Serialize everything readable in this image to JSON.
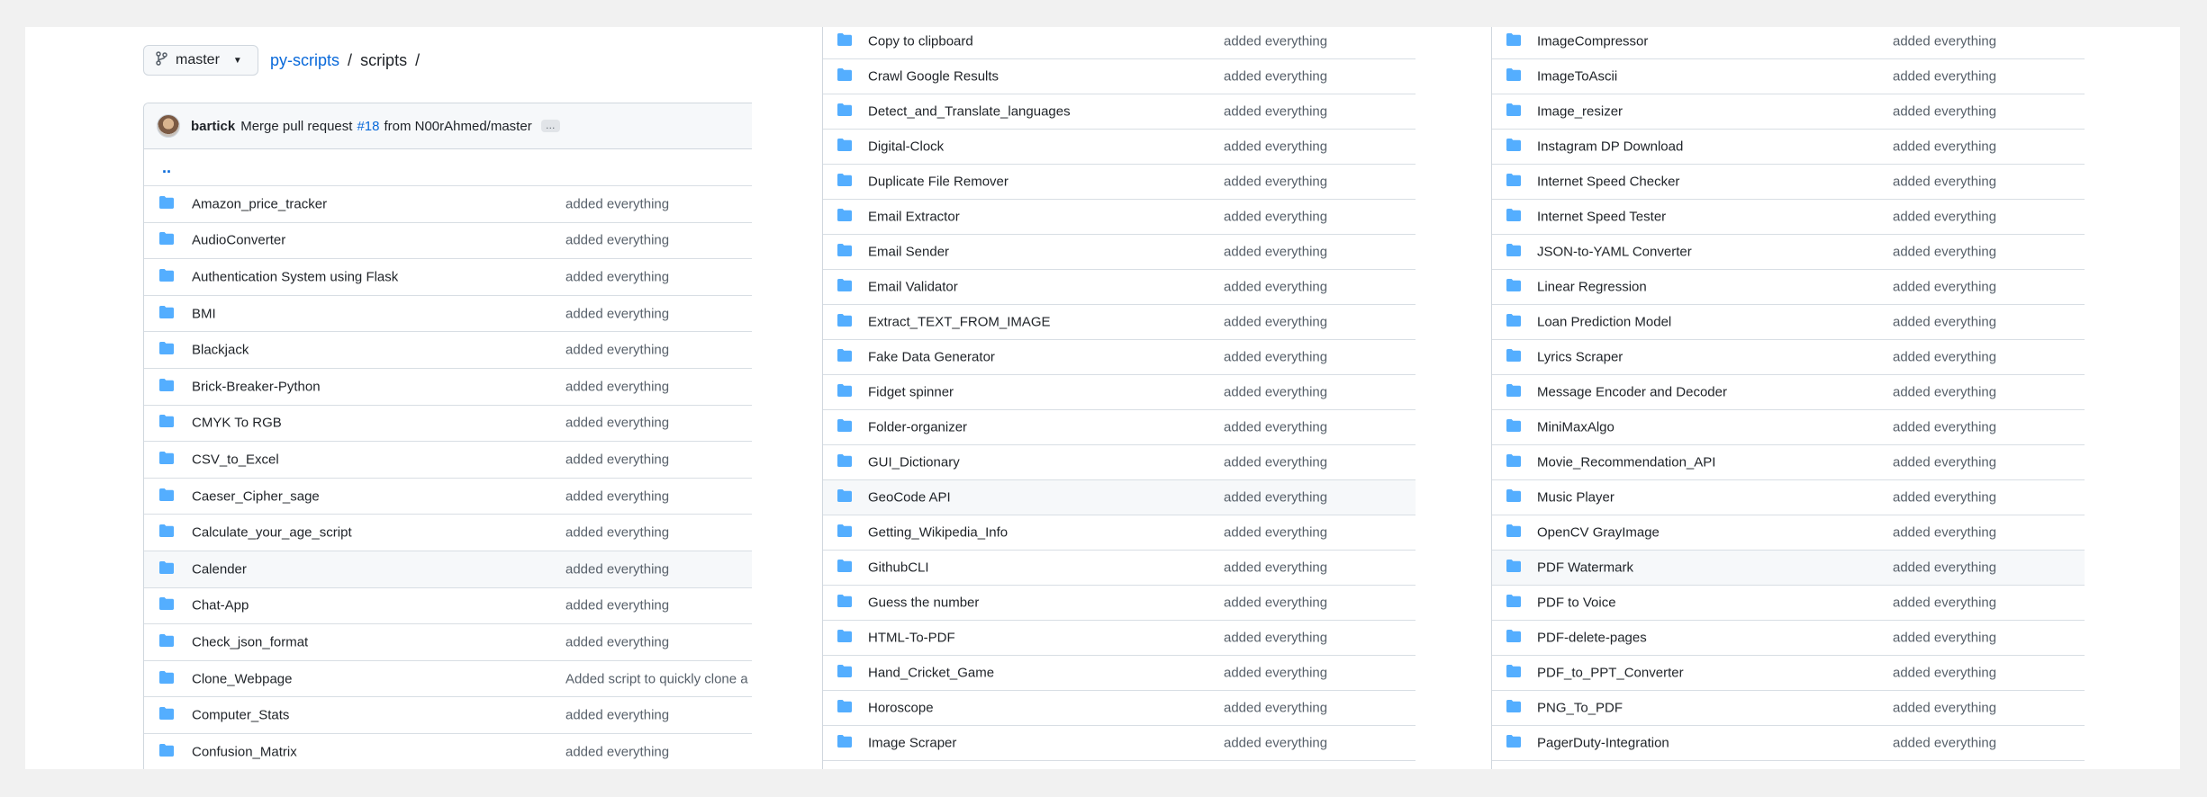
{
  "header": {
    "branch": "master",
    "repo_link": "py-scripts",
    "separator": "/",
    "folder": "scripts",
    "trailing_sep": "/"
  },
  "commit": {
    "author": "bartick",
    "message_prefix": "Merge pull request",
    "pr_number": "#18",
    "message_suffix": "from N00rAhmed/master",
    "ellipsis": "…"
  },
  "parent_dir": "..",
  "colors": {
    "folder": "#54aeff",
    "link": "#0969da"
  },
  "panel1": [
    {
      "name": "Amazon_price_tracker",
      "msg": "added everything"
    },
    {
      "name": "AudioConverter",
      "msg": "added everything"
    },
    {
      "name": "Authentication System using Flask",
      "msg": "added everything"
    },
    {
      "name": "BMI",
      "msg": "added everything"
    },
    {
      "name": "Blackjack",
      "msg": "added everything"
    },
    {
      "name": "Brick-Breaker-Python",
      "msg": "added everything"
    },
    {
      "name": "CMYK To RGB",
      "msg": "added everything"
    },
    {
      "name": "CSV_to_Excel",
      "msg": "added everything"
    },
    {
      "name": "Caeser_Cipher_sage",
      "msg": "added everything"
    },
    {
      "name": "Calculate_your_age_script",
      "msg": "added everything"
    },
    {
      "name": "Calender",
      "msg": "added everything"
    },
    {
      "name": "Chat-App",
      "msg": "added everything"
    },
    {
      "name": "Check_json_format",
      "msg": "added everything"
    },
    {
      "name": "Clone_Webpage",
      "msg": "Added script to quickly clone a"
    },
    {
      "name": "Computer_Stats",
      "msg": "added everything"
    },
    {
      "name": "Confusion_Matrix",
      "msg": "added everything"
    }
  ],
  "panel2": [
    {
      "name": "Copy to clipboard",
      "msg": "added everything"
    },
    {
      "name": "Crawl Google Results",
      "msg": "added everything"
    },
    {
      "name": "Detect_and_Translate_languages",
      "msg": "added everything"
    },
    {
      "name": "Digital-Clock",
      "msg": "added everything"
    },
    {
      "name": "Duplicate File Remover",
      "msg": "added everything"
    },
    {
      "name": "Email Extractor",
      "msg": "added everything"
    },
    {
      "name": "Email Sender",
      "msg": "added everything"
    },
    {
      "name": "Email Validator",
      "msg": "added everything"
    },
    {
      "name": "Extract_TEXT_FROM_IMAGE",
      "msg": "added everything"
    },
    {
      "name": "Fake Data Generator",
      "msg": "added everything"
    },
    {
      "name": "Fidget spinner",
      "msg": "added everything"
    },
    {
      "name": "Folder-organizer",
      "msg": "added everything"
    },
    {
      "name": "GUI_Dictionary",
      "msg": "added everything"
    },
    {
      "name": "GeoCode API",
      "msg": "added everything"
    },
    {
      "name": "Getting_Wikipedia_Info",
      "msg": "added everything"
    },
    {
      "name": "GithubCLI",
      "msg": "added everything"
    },
    {
      "name": "Guess the number",
      "msg": "added everything"
    },
    {
      "name": "HTML-To-PDF",
      "msg": "added everything"
    },
    {
      "name": "Hand_Cricket_Game",
      "msg": "added everything"
    },
    {
      "name": "Horoscope",
      "msg": "added everything"
    },
    {
      "name": "Image Scraper",
      "msg": "added everything"
    }
  ],
  "panel3": [
    {
      "name": "ImageCompressor",
      "msg": "added everything"
    },
    {
      "name": "ImageToAscii",
      "msg": "added everything"
    },
    {
      "name": "Image_resizer",
      "msg": "added everything"
    },
    {
      "name": "Instagram DP Download",
      "msg": "added everything"
    },
    {
      "name": "Internet Speed Checker",
      "msg": "added everything"
    },
    {
      "name": "Internet Speed Tester",
      "msg": "added everything"
    },
    {
      "name": "JSON-to-YAML Converter",
      "msg": "added everything"
    },
    {
      "name": "Linear Regression",
      "msg": "added everything"
    },
    {
      "name": "Loan Prediction Model",
      "msg": "added everything"
    },
    {
      "name": "Lyrics Scraper",
      "msg": "added everything"
    },
    {
      "name": "Message Encoder and Decoder",
      "msg": "added everything"
    },
    {
      "name": "MiniMaxAlgo",
      "msg": "added everything"
    },
    {
      "name": "Movie_Recommendation_API",
      "msg": "added everything"
    },
    {
      "name": "Music Player",
      "msg": "added everything"
    },
    {
      "name": "OpenCV GrayImage",
      "msg": "added everything"
    },
    {
      "name": "PDF Watermark",
      "msg": "added everything"
    },
    {
      "name": "PDF to Voice",
      "msg": "added everything"
    },
    {
      "name": "PDF-delete-pages",
      "msg": "added everything"
    },
    {
      "name": "PDF_to_PPT_Converter",
      "msg": "added everything"
    },
    {
      "name": "PNG_To_PDF",
      "msg": "added everything"
    },
    {
      "name": "PagerDuty-Integration",
      "msg": "added everything"
    }
  ]
}
